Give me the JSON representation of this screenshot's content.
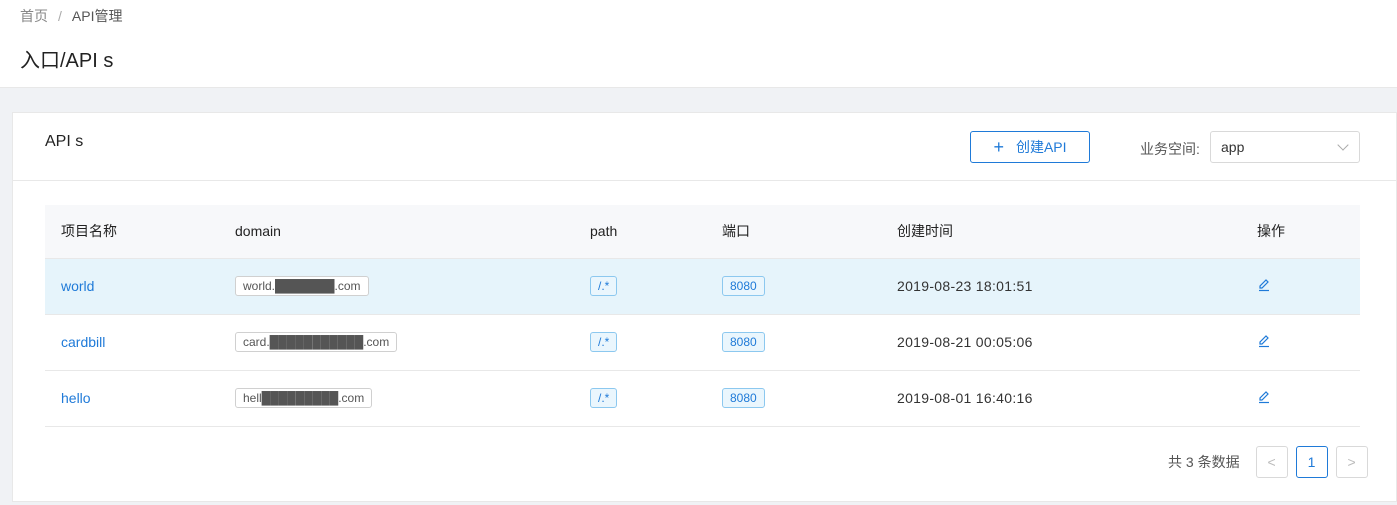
{
  "breadcrumb": {
    "home": "首页",
    "sep": "/",
    "current": "API管理"
  },
  "page_title": "入口/API s",
  "card": {
    "title": "API s",
    "create_label": "创建API",
    "space_label": "业务空间:",
    "space_value": "app"
  },
  "table": {
    "headers": [
      "项目名称",
      "domain",
      "path",
      "端口",
      "创建时间",
      "操作"
    ],
    "rows": [
      {
        "name": "world",
        "domain": "world.███████.com",
        "path": "/.*",
        "port": "8080",
        "created": "2019-08-23 18:01:51"
      },
      {
        "name": "cardbill",
        "domain": "card.███████████.com",
        "path": "/.*",
        "port": "8080",
        "created": "2019-08-21 00:05:06"
      },
      {
        "name": "hello",
        "domain": "hell█████████.com",
        "path": "/.*",
        "port": "8080",
        "created": "2019-08-01 16:40:16"
      }
    ]
  },
  "pagination": {
    "total": "共 3 条数据",
    "current_page": "1",
    "prev": "<",
    "next": ">"
  },
  "colors": {
    "primary": "#1f7ad8",
    "row_highlight": "#e6f4fb"
  }
}
